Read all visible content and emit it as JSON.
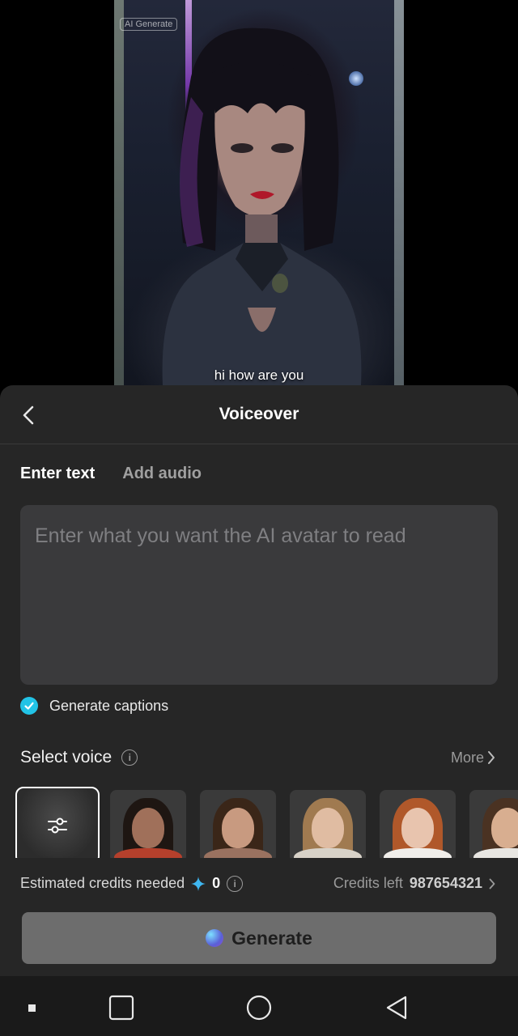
{
  "preview": {
    "badge": "AI Generate",
    "caption": "hi how are you"
  },
  "sheet": {
    "title": "Voiceover",
    "tabs": [
      {
        "label": "Enter text",
        "active": true
      },
      {
        "label": "Add audio",
        "active": false
      }
    ],
    "text_input": {
      "value": "",
      "placeholder": "Enter what you want the AI avatar to read"
    },
    "captions": {
      "label": "Generate captions",
      "checked": true
    },
    "voice": {
      "title": "Select voice",
      "more_label": "More",
      "options": [
        {
          "name": "custom-voice-settings",
          "icon": "sliders-icon",
          "selected": true
        },
        {
          "name": "voice-1",
          "selected": false
        },
        {
          "name": "voice-2",
          "selected": false
        },
        {
          "name": "voice-3",
          "selected": false
        },
        {
          "name": "voice-4",
          "selected": false
        },
        {
          "name": "voice-5",
          "selected": false
        }
      ]
    },
    "credits": {
      "estimated_label": "Estimated credits needed",
      "estimated_value": "0",
      "left_label": "Credits left",
      "left_value": "987654321"
    },
    "generate_label": "Generate"
  },
  "colors": {
    "sheet_bg": "#262626",
    "accent": "#22c3e6",
    "generate_btn": "#6d6d6d"
  },
  "nav_bar": [
    "menu-icon",
    "home-icon",
    "back-icon"
  ]
}
